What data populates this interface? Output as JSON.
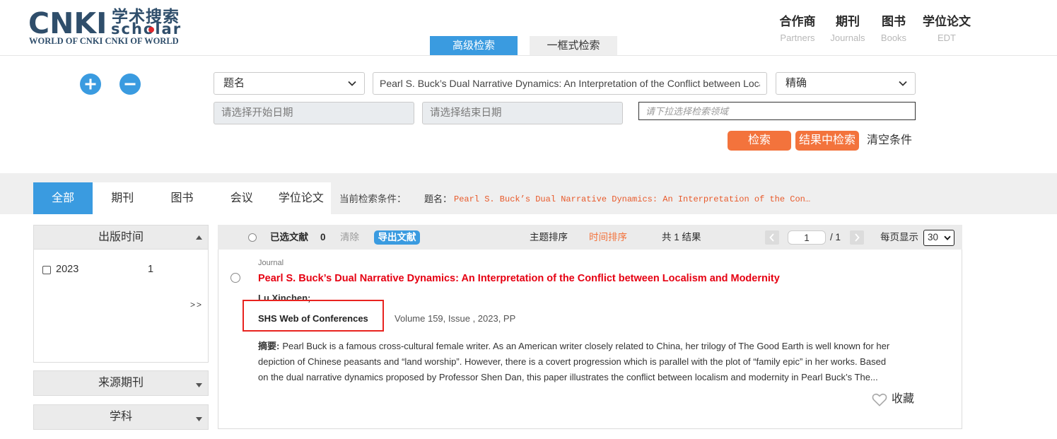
{
  "logo": {
    "brand": "CNKI",
    "cn_title": "学术搜索",
    "sub": "scholar",
    "tagline": "WORLD OF CNKI CNKI OF WORLD"
  },
  "top_nav": [
    {
      "cn": "合作商",
      "en": "Partners"
    },
    {
      "cn": "期刊",
      "en": "Journals"
    },
    {
      "cn": "图书",
      "en": "Books"
    },
    {
      "cn": "学位论文",
      "en": "EDT"
    }
  ],
  "search_mode_tabs": [
    {
      "label": "高级检索",
      "active": true
    },
    {
      "label": "一框式检索",
      "active": false
    }
  ],
  "search_form": {
    "add_row_icon": "plus-circle-icon",
    "remove_row_icon": "minus-circle-icon",
    "field_select": "题名",
    "query_value": "Pearl S. Buck’s Dual Narrative Dynamics: An Interpretation of the Conflict between Localis",
    "match_select": "精确",
    "start_date_placeholder": "请选择开始日期",
    "end_date_placeholder": "请选择结束日期",
    "domain_placeholder": "请下拉选择检索领域",
    "search_button": "检索",
    "search_within_button": "结果中检索",
    "clear_button": "清空条件"
  },
  "result_type_tabs": [
    {
      "label": "全部",
      "active": true
    },
    {
      "label": "期刊",
      "active": false
    },
    {
      "label": "图书",
      "active": false
    },
    {
      "label": "会议",
      "active": false
    },
    {
      "label": "学位论文",
      "active": false
    }
  ],
  "current_condition": {
    "label": "当前检索条件：",
    "field": "题名：",
    "value": "Pearl S. Buck’s Dual Narrative Dynamics: An Interpretation of the Con…"
  },
  "facets": [
    {
      "title": "出版时间",
      "expanded": true,
      "items": [
        {
          "label": "2023",
          "count": "1",
          "checked": false
        }
      ],
      "more": ">>"
    },
    {
      "title": "来源期刊",
      "expanded": false
    },
    {
      "title": "学科",
      "expanded": false
    }
  ],
  "toolbar": {
    "selected_label": "已选文献",
    "selected_count": "0",
    "clear": "清除",
    "export": "导出文献",
    "sort_topic": "主题排序",
    "sort_time": "时间排序",
    "total": "共 1 结果",
    "page_input": "1",
    "page_total": "/ 1",
    "per_page_label": "每页显示",
    "per_page_value": "30"
  },
  "results": [
    {
      "type": "Journal",
      "title": "Pearl S. Buck’s Dual Narrative Dynamics: An Interpretation of the Conflict between Localism and Modernity",
      "authors": "Lu Xinchen;",
      "source": "SHS Web of Conferences",
      "details": "Volume 159, Issue , 2023, PP",
      "abstract_label": "摘要:",
      "abstract_lines": [
        "Pearl Buck is a famous cross-cultural female writer. As an American writer closely related to China, her trilogy of The Good Earth is well known for her",
        "depiction of Chinese peasants and “land worship”. However, there is a covert progression which is parallel with the plot of “family epic” in her works. Based",
        "on the dual narrative dynamics proposed by Professor Shen Dan, this paper illustrates the conflict between localism and modernity in Pearl Buck’s The..."
      ],
      "favorite": "收藏"
    }
  ],
  "colors": {
    "primary_blue": "#3a9be0",
    "action_orange": "#f3733c",
    "title_red": "#e60012",
    "condition_red": "#e85a2b",
    "highlight_red": "#e8231f"
  }
}
